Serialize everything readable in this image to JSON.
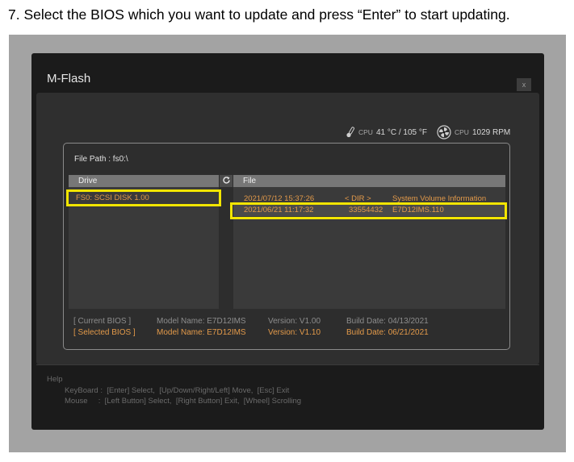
{
  "instruction": "7. Select the BIOS which you want to update and press “Enter” to start updating.",
  "window": {
    "title": "M-Flash",
    "close_label": "x"
  },
  "status": {
    "cpu_temp_label": "CPU",
    "cpu_temp_value": "41 °C / 105 °F",
    "cpu_fan_label": "CPU",
    "cpu_fan_value": "1029 RPM"
  },
  "file_path": "File Path : fs0:\\",
  "drive_header": "Drive",
  "file_header": "File",
  "drives": [
    "FS0: SCSI DISK 1.00"
  ],
  "files": [
    {
      "date": "2021/07/12 15:37:26",
      "size": "< DIR >",
      "name": "System Volume Information"
    },
    {
      "date": "2021/06/21 11:17:32",
      "size": "33554432",
      "name": "E7D12IMS.110"
    }
  ],
  "bios": [
    {
      "label": "[ Current BIOS  ]",
      "model": "Model Name: E7D12IMS",
      "version": "Version: V1.00",
      "build": "Build Date: 04/13/2021"
    },
    {
      "label": "[ Selected BIOS ]",
      "model": "Model Name: E7D12IMS",
      "version": "Version: V1.10",
      "build": "Build Date: 06/21/2021"
    }
  ],
  "help": {
    "title": "Help",
    "line1": "KeyBoard :  [Enter] Select,  [Up/Down/Right/Left] Move,  [Esc] Exit",
    "line2": "Mouse     :  [Left Button] Select,  [Right Button] Exit,  [Wheel] Scrolling"
  },
  "colors": {
    "accent": "#e39a4a",
    "highlight": "#f2e500",
    "background": "#1b1b1b"
  },
  "icons": {
    "temp": "thermometer-icon",
    "fan": "fan-icon",
    "refresh": "refresh-icon"
  }
}
